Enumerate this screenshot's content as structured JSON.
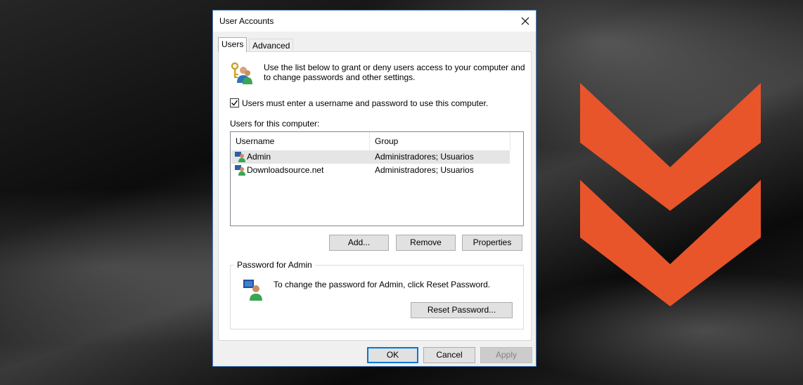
{
  "window": {
    "title": "User Accounts"
  },
  "tabs": [
    {
      "label": "Users",
      "active": true
    },
    {
      "label": "Advanced",
      "active": false
    }
  ],
  "intro": {
    "icon": "users-keys-icon",
    "text": "Use the list below to grant or deny users access to your computer and to change passwords and other settings."
  },
  "require_login": {
    "checked": true,
    "label": "Users must enter a username and password to use this computer."
  },
  "users_list": {
    "label": "Users for this computer:",
    "columns": [
      "Username",
      "Group"
    ],
    "rows": [
      {
        "username": "Admin",
        "group": "Administradores; Usuarios",
        "selected": true,
        "icon": "user-icon"
      },
      {
        "username": "Downloadsource.net",
        "group": "Administradores; Usuarios",
        "selected": false,
        "icon": "user-icon"
      }
    ]
  },
  "list_buttons": {
    "add": "Add...",
    "remove": "Remove",
    "properties": "Properties"
  },
  "password_group": {
    "legend": "Password for Admin",
    "icon": "user-password-icon",
    "text": "To change the password for Admin, click Reset Password.",
    "reset_button": "Reset Password..."
  },
  "dialog_buttons": {
    "ok": "OK",
    "cancel": "Cancel",
    "apply": "Apply"
  },
  "colors": {
    "accent": "#0078d7",
    "wallpaper_arrow": "#e8552b",
    "window_border": "#4a7fc1",
    "selection": "#e5e5e5"
  }
}
